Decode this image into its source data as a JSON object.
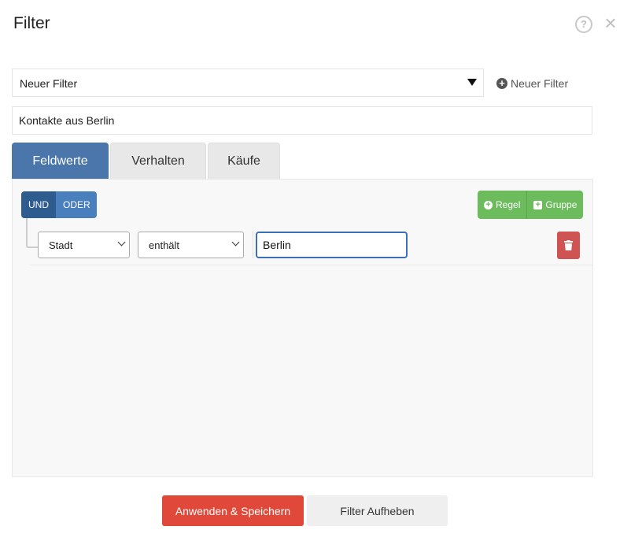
{
  "modal": {
    "title": "Filter",
    "help_glyph": "?",
    "close_glyph": "×"
  },
  "filter_select": {
    "selected": "Neuer Filter"
  },
  "new_filter_link": {
    "label": "Neuer Filter"
  },
  "filter_name": {
    "value": "Kontakte aus Berlin"
  },
  "tabs": [
    {
      "label": "Feldwerte",
      "active": true
    },
    {
      "label": "Verhalten",
      "active": false
    },
    {
      "label": "Käufe",
      "active": false
    }
  ],
  "builder": {
    "logic": {
      "and_label": "UND",
      "or_label": "ODER",
      "selected": "UND"
    },
    "add_rule_label": "Regel",
    "add_group_label": "Gruppe",
    "rules": [
      {
        "field": "Stadt",
        "operator": "enthält",
        "value": "Berlin"
      }
    ]
  },
  "footer": {
    "apply_label": "Anwenden & Speichern",
    "clear_label": "Filter Aufheben"
  },
  "colors": {
    "tab_active": "#4a76ab",
    "logic_and": "#2f5c8f",
    "logic_or": "#4a7fbd",
    "add_green": "#6cbb5d",
    "delete_red": "#d05353",
    "apply_red": "#e0493a",
    "input_focus": "#3d6eb8"
  }
}
